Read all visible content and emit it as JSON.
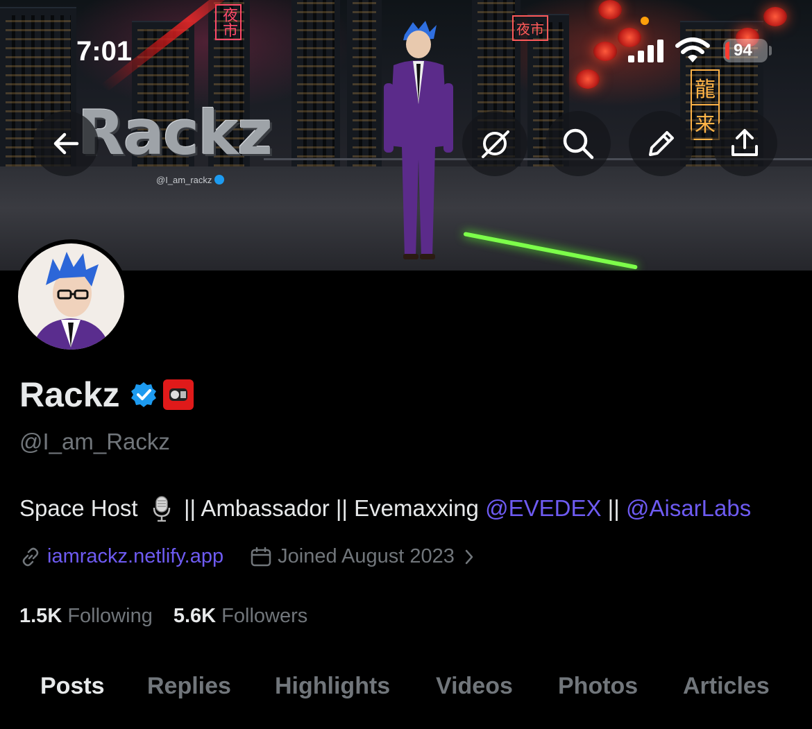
{
  "status_bar": {
    "time": "7:01",
    "battery": "94"
  },
  "banner": {
    "logo_text": "Rackz",
    "handle": "@I_am_rackz",
    "signs": [
      "夜市",
      "夜市",
      "龍",
      "来"
    ]
  },
  "header": {
    "back_icon": "arrow-left-icon",
    "actions": [
      "grok-icon",
      "search-icon",
      "pencil-icon",
      "share-icon"
    ]
  },
  "profile": {
    "name": "Rackz",
    "handle": "@I_am_Rackz",
    "bio": {
      "part1": "Space Host",
      "part2": "|| Ambassador || Evemaxxing",
      "mention1": "@EVEDEX",
      "sep": "||",
      "mention2": "@AisarLabs"
    },
    "website": "iamrackz.netlify.app",
    "joined": "Joined August 2023"
  },
  "stats": {
    "following_count": "1.5K",
    "following_label": "Following",
    "followers_count": "5.6K",
    "followers_label": "Followers"
  },
  "tabs": [
    "Posts",
    "Replies",
    "Highlights",
    "Videos",
    "Photos",
    "Articles"
  ],
  "colors": {
    "accent": "#6e5bf2",
    "verified": "#1d9bf0",
    "muted": "#71767b",
    "text": "#e7e9ea"
  }
}
